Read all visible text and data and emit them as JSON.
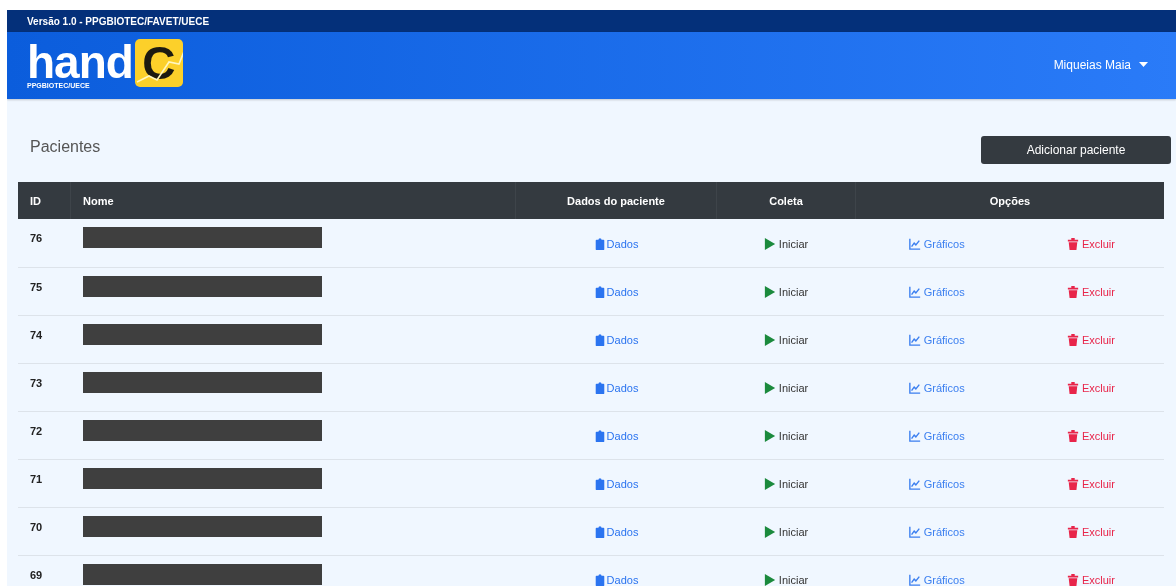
{
  "version_bar": {
    "text": "Versão 1.0 - PPGBIOTEC/FAVET/UECE"
  },
  "logo": {
    "word": "hand",
    "letter": "C",
    "subtitle": "PPGBIOTEC/UECE"
  },
  "user_menu": {
    "label": "Miqueias Maia"
  },
  "page_title": "Pacientes",
  "add_button": "Adicionar paciente",
  "table": {
    "columns": [
      {
        "label": "ID"
      },
      {
        "label": "Nome"
      },
      {
        "label": "Dados do paciente"
      },
      {
        "label": "Coleta"
      },
      {
        "label": "Opções"
      }
    ],
    "rows": [
      {
        "id": "76",
        "data": "Dados",
        "collect": "Iniciar",
        "charts": "Gráficos",
        "delete": "Excluir"
      },
      {
        "id": "75",
        "data": "Dados",
        "collect": "Iniciar",
        "charts": "Gráficos",
        "delete": "Excluir"
      },
      {
        "id": "74",
        "data": "Dados",
        "collect": "Iniciar",
        "charts": "Gráficos",
        "delete": "Excluir"
      },
      {
        "id": "73",
        "data": "Dados",
        "collect": "Iniciar",
        "charts": "Gráficos",
        "delete": "Excluir"
      },
      {
        "id": "72",
        "data": "Dados",
        "collect": "Iniciar",
        "charts": "Gráficos",
        "delete": "Excluir"
      },
      {
        "id": "71",
        "data": "Dados",
        "collect": "Iniciar",
        "charts": "Gráficos",
        "delete": "Excluir"
      },
      {
        "id": "70",
        "data": "Dados",
        "collect": "Iniciar",
        "charts": "Gráficos",
        "delete": "Excluir"
      },
      {
        "id": "69",
        "data": "Dados",
        "collect": "Iniciar",
        "charts": "Gráficos",
        "delete": "Excluir"
      }
    ]
  }
}
